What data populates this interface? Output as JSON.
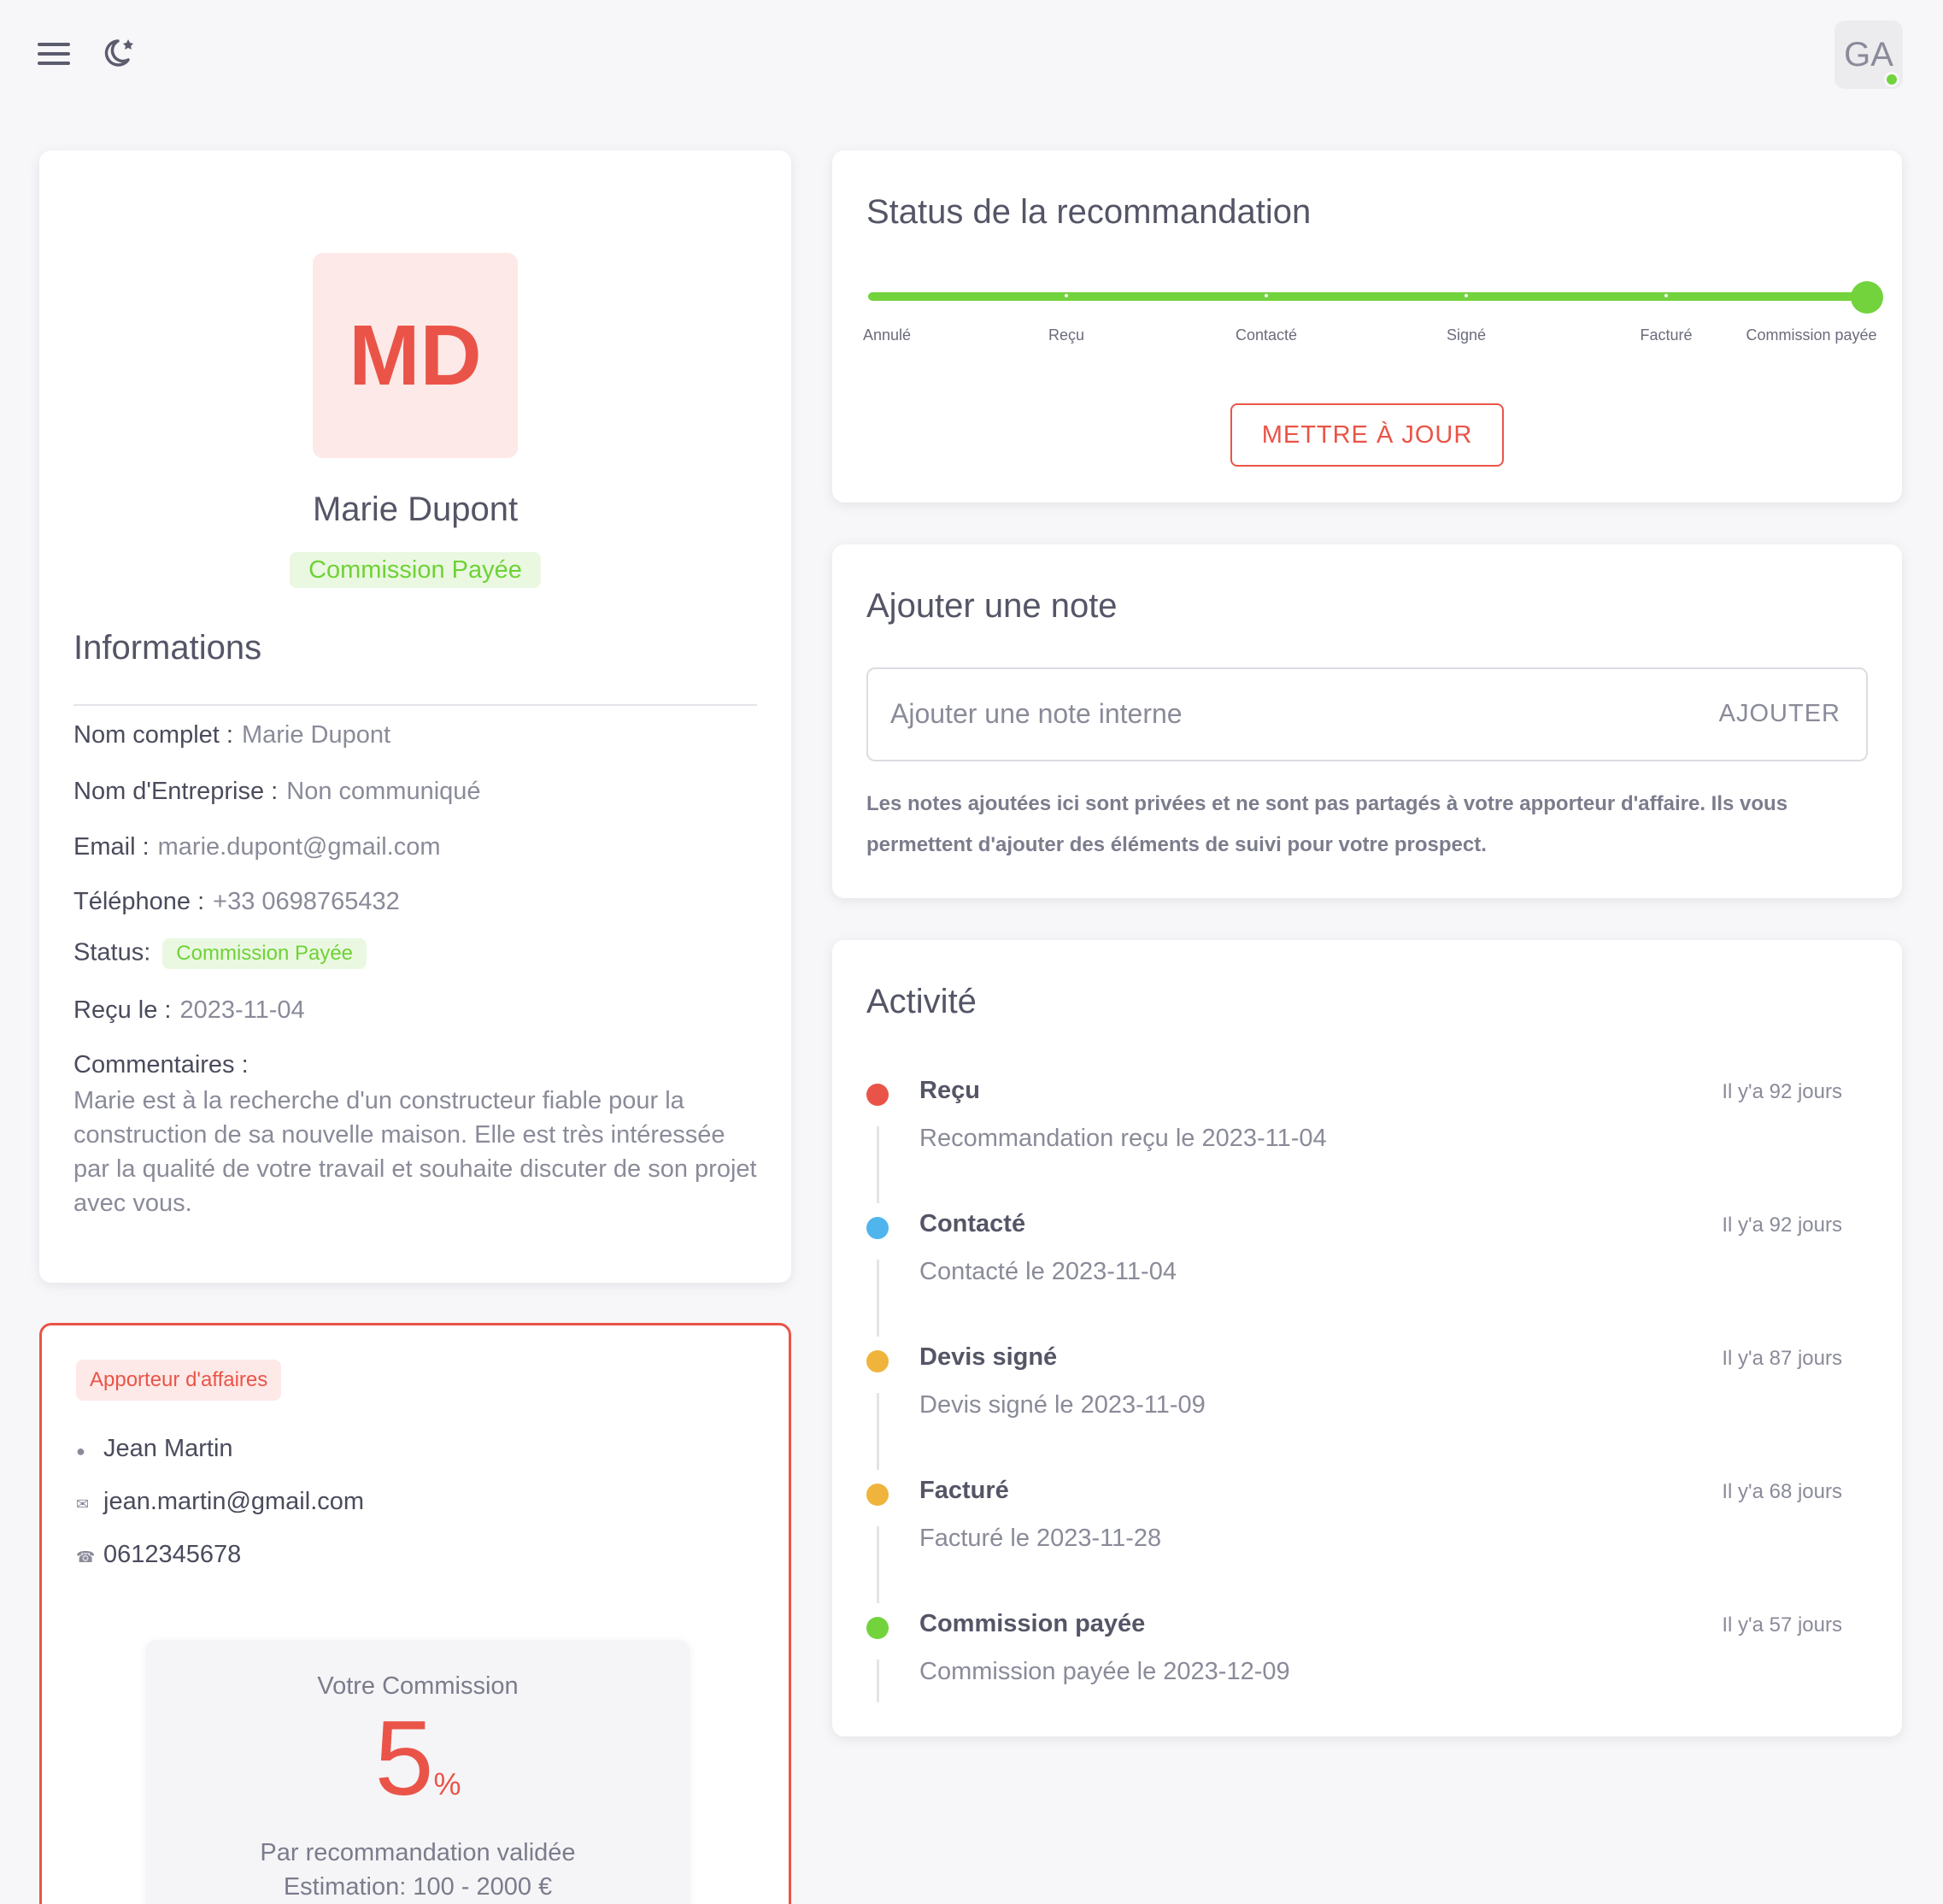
{
  "topbar": {
    "avatar_initials": "GA"
  },
  "profile": {
    "initials": "MD",
    "name": "Marie Dupont",
    "status_badge": "Commission Payée",
    "info_title": "Informations",
    "fields": {
      "full_name_label": "Nom complet :",
      "full_name_value": "Marie Dupont",
      "company_label": "Nom d'Entreprise :",
      "company_value": "Non communiqué",
      "email_label": "Email :",
      "email_value": "marie.dupont@gmail.com",
      "phone_label": "Téléphone :",
      "phone_value": "+33 0698765432",
      "status_label": "Status:",
      "status_value": "Commission Payée",
      "received_label": "Reçu le :",
      "received_value": "2023-11-04",
      "comments_label": "Commentaires :",
      "comments_value": "Marie est à la recherche d'un constructeur fiable pour la construction de sa nouvelle maison. Elle est très intéressée par la qualité de votre travail et souhaite discuter de son projet avec vous."
    }
  },
  "apporteur": {
    "badge": "Apporteur d'affaires",
    "name": "Jean Martin",
    "email": "jean.martin@gmail.com",
    "phone": "0612345678",
    "commission": {
      "title": "Votre Commission",
      "value": "5",
      "unit": "%",
      "subtitle": "Par recommandation validée",
      "estimate": "Estimation: 100 - 2000 €"
    }
  },
  "status_card": {
    "title": "Status de la recommandation",
    "steps": [
      "Annulé",
      "Reçu",
      "Contacté",
      "Signé",
      "Facturé",
      "Commission payée"
    ],
    "current_step_index": 5,
    "update_button": "METTRE À JOUR"
  },
  "note_card": {
    "title": "Ajouter une note",
    "placeholder": "Ajouter une note interne",
    "add_button": "AJOUTER",
    "help": "Les notes ajoutées ici sont privées et ne sont pas partagés à votre apporteur d'affaire. Ils vous permettent d'ajouter des éléments de suivi pour votre prospect."
  },
  "activity": {
    "title": "Activité",
    "items": [
      {
        "title": "Reçu",
        "desc": "Recommandation reçu le 2023-11-04",
        "time": "Il y'a 92 jours",
        "color": "#ea5448"
      },
      {
        "title": "Contacté",
        "desc": "Contacté le 2023-11-04",
        "time": "Il y'a 92 jours",
        "color": "#4fb5ec"
      },
      {
        "title": "Devis signé",
        "desc": "Devis signé le 2023-11-09",
        "time": "Il y'a 87 jours",
        "color": "#f0b43c"
      },
      {
        "title": "Facturé",
        "desc": "Facturé le 2023-11-28",
        "time": "Il y'a 68 jours",
        "color": "#f0b43c"
      },
      {
        "title": "Commission payée",
        "desc": "Commission payée le 2023-12-09",
        "time": "Il y'a 57 jours",
        "color": "#72d33d"
      }
    ]
  }
}
